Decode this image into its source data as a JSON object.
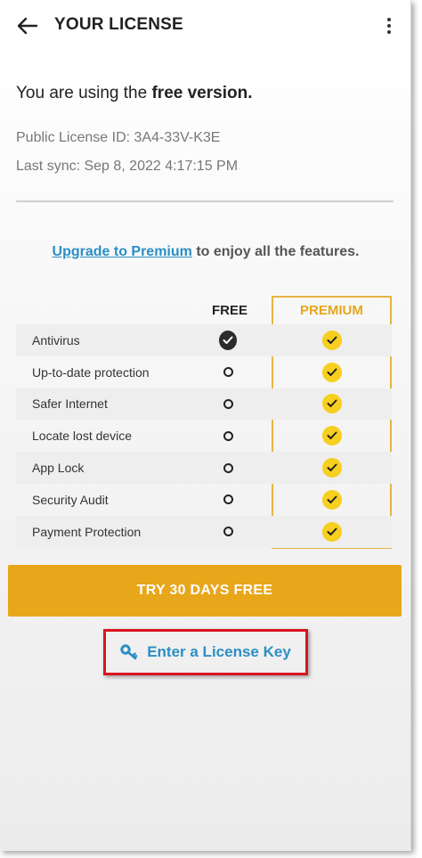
{
  "appbar": {
    "title": "YOUR LICENSE",
    "back_icon": "arrow-left-icon",
    "menu_icon": "more-vertical-icon"
  },
  "status": {
    "prefix": "You are using the ",
    "emphasis": "free version."
  },
  "license_info": {
    "public_id": "Public License ID: 3A4-33V-K3E",
    "last_sync": "Last sync: Sep 8, 2022 4:17:15 PM"
  },
  "upgrade": {
    "link": "Upgrade to Premium",
    "rest": " to enjoy all the features."
  },
  "table": {
    "free_header": "FREE",
    "premium_header": "PREMIUM",
    "rows": [
      {
        "label": "Antivirus",
        "free": "check",
        "premium": "check"
      },
      {
        "label": "Up-to-date protection",
        "free": "none",
        "premium": "check"
      },
      {
        "label": "Safer Internet",
        "free": "none",
        "premium": "check"
      },
      {
        "label": "Locate lost device",
        "free": "none",
        "premium": "check"
      },
      {
        "label": "App Lock",
        "free": "none",
        "premium": "check"
      },
      {
        "label": "Security Audit",
        "free": "none",
        "premium": "check"
      },
      {
        "label": "Payment Protection",
        "free": "none",
        "premium": "check"
      }
    ]
  },
  "actions": {
    "trial_label": "TRY 30 DAYS FREE",
    "license_key_label": "Enter a License Key",
    "license_key_icon": "key-icon"
  },
  "colors": {
    "accent_orange": "#e8a61a",
    "premium_yellow": "#f6cf1f",
    "link_blue": "#2a8fc4",
    "highlight_red": "#d8161f"
  }
}
